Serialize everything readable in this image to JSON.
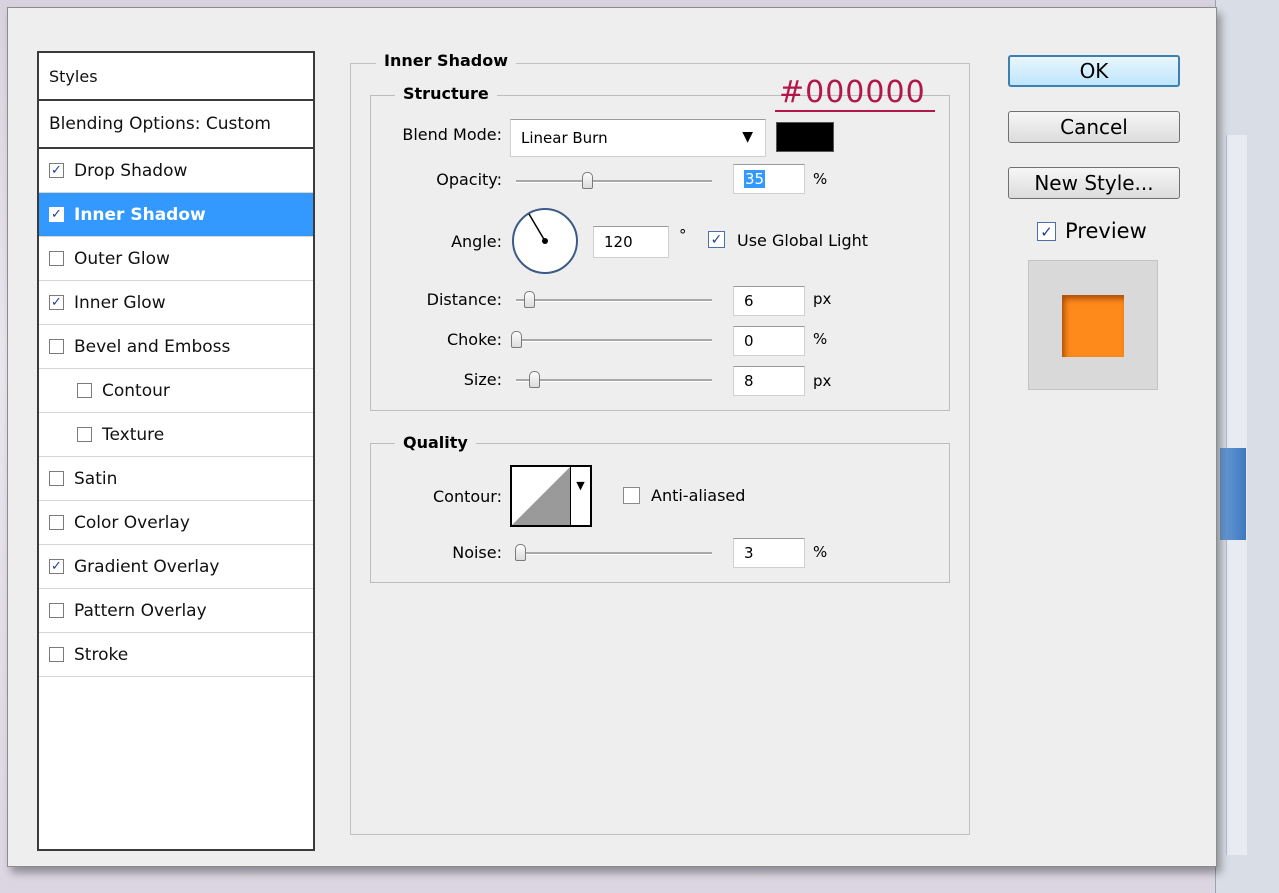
{
  "styles_list": {
    "header": "Styles",
    "blending": "Blending Options: Custom",
    "items": [
      {
        "label": "Drop Shadow",
        "checked": true
      },
      {
        "label": "Inner Shadow",
        "checked": true,
        "selected": true
      },
      {
        "label": "Outer Glow",
        "checked": false
      },
      {
        "label": "Inner Glow",
        "checked": true
      },
      {
        "label": "Bevel and Emboss",
        "checked": false
      },
      {
        "label": "Contour",
        "checked": false
      },
      {
        "label": "Texture",
        "checked": false
      },
      {
        "label": "Satin",
        "checked": false
      },
      {
        "label": "Color Overlay",
        "checked": false
      },
      {
        "label": "Gradient Overlay",
        "checked": true
      },
      {
        "label": "Pattern Overlay",
        "checked": false
      },
      {
        "label": "Stroke",
        "checked": false
      }
    ]
  },
  "panel": {
    "title": "Inner Shadow",
    "structure": {
      "title": "Structure",
      "blend_mode_label": "Blend Mode:",
      "blend_mode_value": "Linear Burn",
      "shadow_color": "#000000",
      "opacity_label": "Opacity:",
      "opacity_value": "35",
      "opacity_unit": "%",
      "angle_label": "Angle:",
      "angle_value": "120",
      "angle_unit": "°",
      "global_light_label": "Use Global Light",
      "global_light_checked": true,
      "distance_label": "Distance:",
      "distance_value": "6",
      "distance_unit": "px",
      "choke_label": "Choke:",
      "choke_value": "0",
      "choke_unit": "%",
      "size_label": "Size:",
      "size_value": "8",
      "size_unit": "px"
    },
    "quality": {
      "title": "Quality",
      "contour_label": "Contour:",
      "anti_aliased_label": "Anti-aliased",
      "anti_aliased_checked": false,
      "noise_label": "Noise:",
      "noise_value": "3",
      "noise_unit": "%"
    }
  },
  "annotation": {
    "text": "#000000",
    "color": "#b2174b"
  },
  "buttons": {
    "ok": "OK",
    "cancel": "Cancel",
    "new_style": "New Style...",
    "preview_label": "Preview",
    "preview_checked": true
  },
  "preview_swatch_color": "#ff8a1c"
}
